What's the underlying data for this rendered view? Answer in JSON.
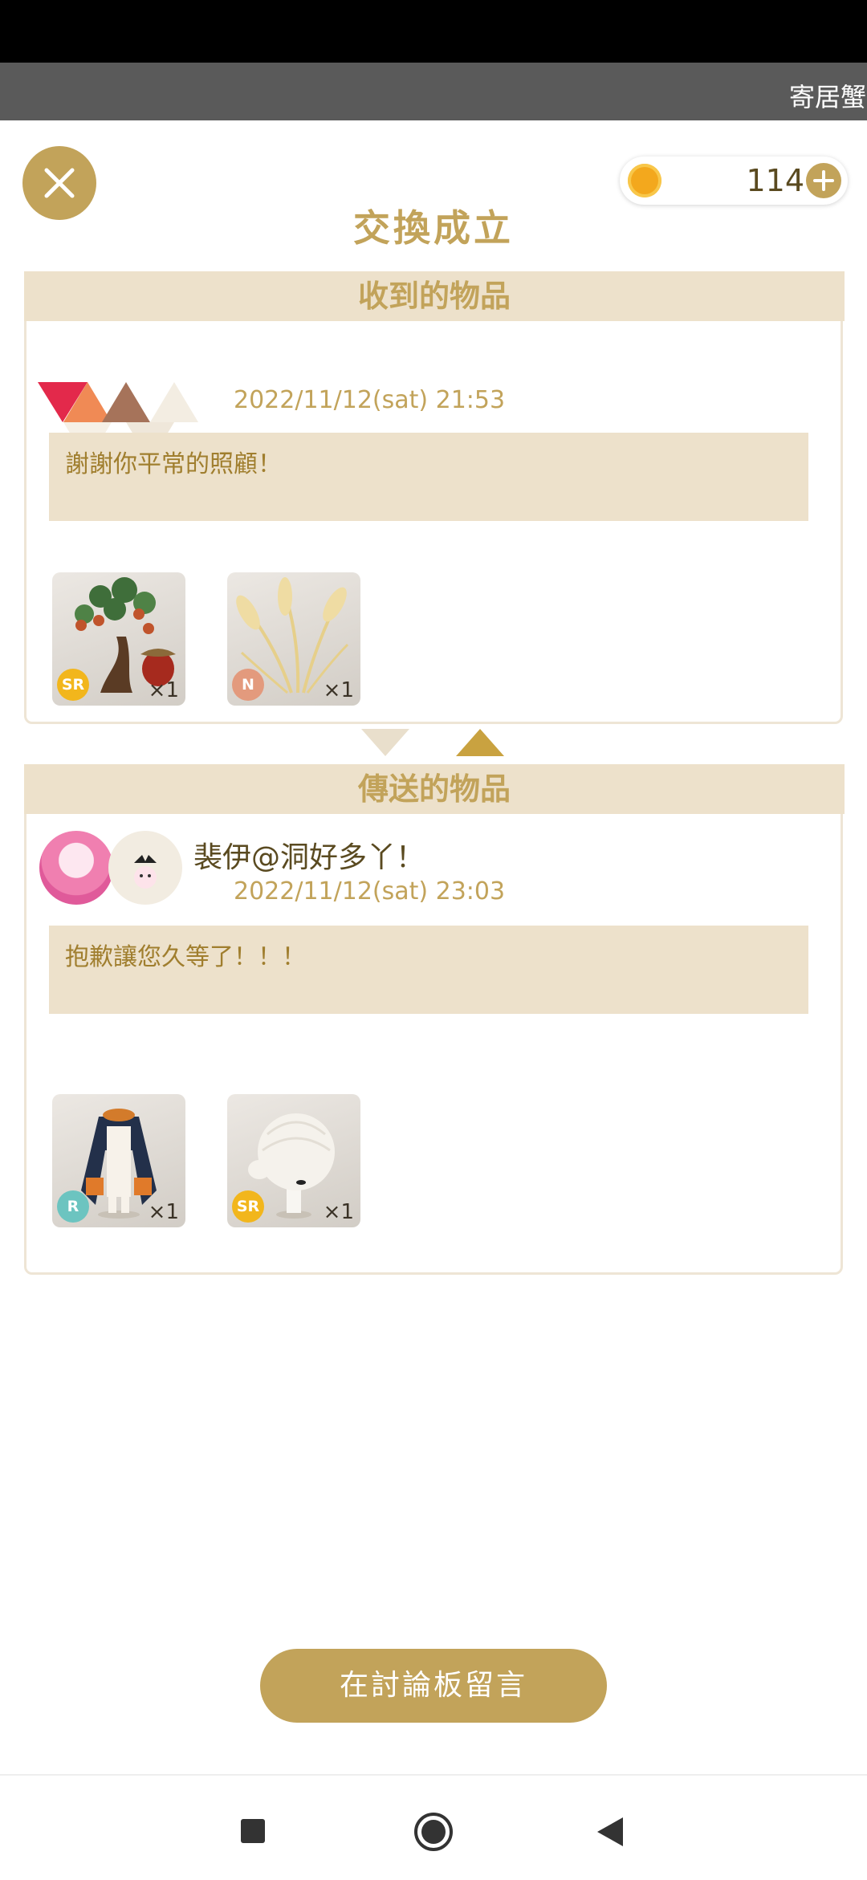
{
  "notification": {
    "text": "寄居蟹"
  },
  "header": {
    "title": "交換成立",
    "coin_count": "114"
  },
  "received": {
    "section_title": "收到的物品",
    "timestamp": "2022/11/12(sat) 21:53",
    "message": "謝謝你平常的照顧！",
    "items": [
      {
        "rarity": "SR",
        "rarity_color": "#f2b61c",
        "qty": "×1",
        "icon": "oak-tree-with-acorn-icon"
      },
      {
        "rarity": "N",
        "rarity_color": "#e39a7d",
        "qty": "×1",
        "icon": "pampas-grass-icon"
      }
    ]
  },
  "sent": {
    "section_title": "傳送的物品",
    "sender_name": "裴伊@洞好多丫！",
    "timestamp": "2022/11/12(sat) 23:03",
    "message": "抱歉讓您久等了！！！",
    "items": [
      {
        "rarity": "R",
        "rarity_color": "#6cc4c0",
        "qty": "×1",
        "icon": "cloak-outfit-icon"
      },
      {
        "rarity": "SR",
        "rarity_color": "#f2b61c",
        "qty": "×1",
        "icon": "white-hair-icon"
      }
    ]
  },
  "footer": {
    "board_button": "在討論板留言"
  },
  "colors": {
    "accent": "#c2a35a",
    "panel": "#ede1cb",
    "text_dark": "#5a4a20"
  }
}
